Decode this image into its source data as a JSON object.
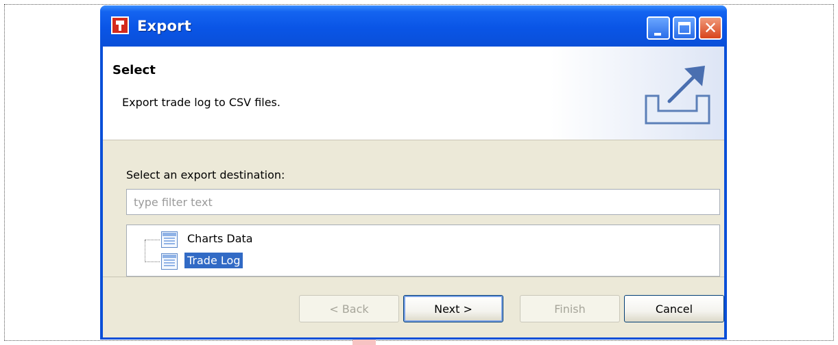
{
  "window": {
    "title": "Export",
    "icon": "app-logo-icon",
    "controls": [
      "minimize-icon",
      "maximize-icon",
      "close-icon"
    ]
  },
  "header": {
    "title": "Select",
    "description": "Export trade log to CSV files.",
    "graphic": "export-arrow-icon"
  },
  "main": {
    "destination_label": "Select an export destination:",
    "filter_placeholder": "type filter text",
    "filter_value": "",
    "tree": [
      {
        "label": "Charts Data",
        "icon": "table-icon",
        "selected": false
      },
      {
        "label": "Trade Log",
        "icon": "table-icon",
        "selected": true
      }
    ]
  },
  "buttons": {
    "back": {
      "label": "< Back",
      "enabled": false
    },
    "next": {
      "label": "Next >",
      "enabled": true
    },
    "finish": {
      "label": "Finish",
      "enabled": false
    },
    "cancel": {
      "label": "Cancel",
      "enabled": true
    }
  },
  "colors": {
    "titlebar": "#0a55e6",
    "selection": "#316ac5",
    "panel": "#ece9d8"
  }
}
